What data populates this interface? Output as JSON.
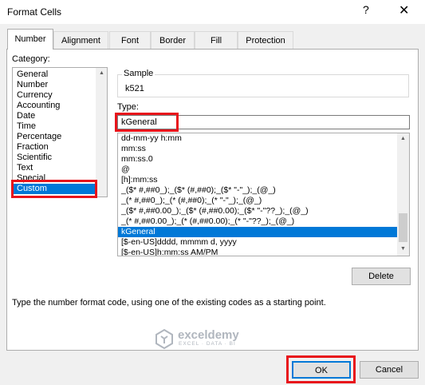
{
  "window": {
    "title": "Format Cells",
    "help": "?",
    "close": "✕"
  },
  "tabs": [
    {
      "label": "Number",
      "active": true
    },
    {
      "label": "Alignment",
      "active": false
    },
    {
      "label": "Font",
      "active": false
    },
    {
      "label": "Border",
      "active": false
    },
    {
      "label": "Fill",
      "active": false
    },
    {
      "label": "Protection",
      "active": false
    }
  ],
  "category": {
    "label": "Category:",
    "items": [
      "General",
      "Number",
      "Currency",
      "Accounting",
      "Date",
      "Time",
      "Percentage",
      "Fraction",
      "Scientific",
      "Text",
      "Special",
      "Custom"
    ],
    "selected": "Custom"
  },
  "sample": {
    "label": "Sample",
    "value": "k521"
  },
  "type": {
    "label": "Type:",
    "value": "kGeneral",
    "items": [
      "dd-mm-yy h:mm",
      "mm:ss",
      "mm:ss.0",
      "@",
      "[h]:mm:ss",
      "_($* #,##0_);_($* (#,##0);_($* \"-\"_);_(@_)",
      "_(* #,##0_);_(* (#,##0);_(* \"-\"_);_(@_)",
      "_($* #,##0.00_);_($* (#,##0.00);_($* \"-\"??_);_(@_)",
      "_(* #,##0.00_);_(* (#,##0.00);_(* \"-\"??_);_(@_)",
      "kGeneral",
      "[$-en-US]dddd, mmmm d, yyyy",
      "[$-en-US]h:mm:ss AM/PM"
    ],
    "selected": "kGeneral"
  },
  "delete_label": "Delete",
  "hint": "Type the number format code, using one of the existing codes as a starting point.",
  "ok_label": "OK",
  "cancel_label": "Cancel",
  "watermark": {
    "name": "exceldemy",
    "tagline": "EXCEL · DATA · BI"
  },
  "colors": {
    "selection": "#0078d7",
    "highlight": "#e8141b"
  }
}
